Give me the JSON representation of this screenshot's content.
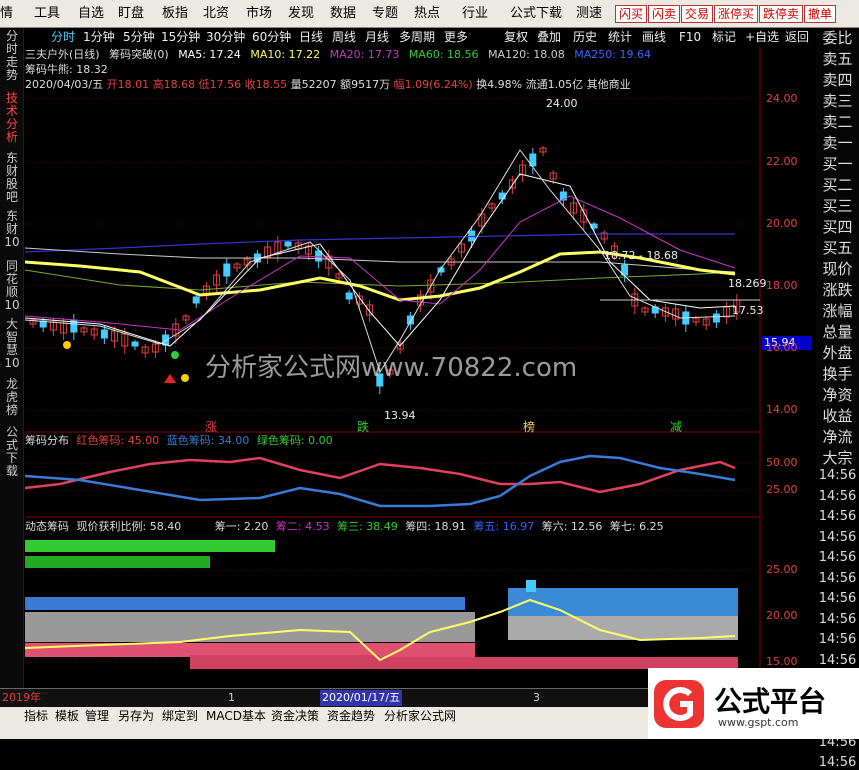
{
  "top_menu": {
    "items": [
      "情",
      "工具",
      "自选",
      "盯盘",
      "板指",
      "北资",
      "市场",
      "发现",
      "数据",
      "专题",
      "热点",
      "行业",
      "公式下载",
      "测速"
    ],
    "red_buttons": [
      "闪买",
      "闪卖",
      "交易",
      "涨停买",
      "跌停卖",
      "撤单"
    ]
  },
  "sidebar": {
    "items": [
      "分时走势",
      "技术分析",
      "东财股吧",
      "东财10",
      "同花顺10",
      "大智慧10",
      "龙虎榜",
      "公式下载"
    ],
    "active_index": 1
  },
  "periods": {
    "items": [
      "分时",
      "1分钟",
      "5分钟",
      "15分钟",
      "30分钟",
      "60分钟",
      "日线",
      "周线",
      "月线",
      "多周期",
      "更多"
    ],
    "active_index": 0
  },
  "toolbar": {
    "items": [
      "复权",
      "叠加",
      "历史",
      "统计",
      "画线",
      "F10",
      "标记",
      "+自选",
      "返回"
    ]
  },
  "stock": {
    "name": "三夫户外(日线)",
    "indicator": "筹码突破(0)",
    "ma5": "MA5: 17.24",
    "ma10": "MA10: 17.22",
    "ma20": "MA20: 17.73",
    "ma60": "MA60: 18.56",
    "ma120": "MA120: 18.08",
    "ma250": "MA250: 19.64",
    "chip_line": "筹码牛熊: 18.32"
  },
  "ohlc": {
    "date": "2020/04/03/五",
    "open": "开18.01",
    "high": "高18.68",
    "low": "低17.56",
    "close": "收18.55",
    "vol": "量52207",
    "amount": "额9517万",
    "change": "幅1.09(6.24%)",
    "turnover": "换4.98%",
    "float": "流通1.05亿",
    "sector": "其他商业"
  },
  "price_axis": [
    "24.00",
    "22.00",
    "20.00",
    "18.00",
    "16.00",
    "14.00"
  ],
  "price_labels": {
    "high": "24.00",
    "low": "13.94",
    "mid": "18.72 - 18.68",
    "r1": "18.269",
    "r2": "17.53",
    "current": "15.94"
  },
  "markers": [
    "涨",
    "跌",
    "榜",
    "减"
  ],
  "right_panel": [
    "委比",
    "卖五",
    "卖四",
    "卖三",
    "卖二",
    "卖一",
    "买一",
    "买二",
    "买三",
    "买四",
    "买五",
    "现价",
    "涨跌",
    "涨幅",
    "总量",
    "外盘",
    "换手",
    "净资",
    "收益",
    "净流",
    "大宗"
  ],
  "right_times": [
    "14:56",
    "14:56",
    "14:56",
    "14:56",
    "14:56",
    "14:56",
    "14:56",
    "14:56",
    "14:56",
    "14:56",
    "14:56",
    "14:56",
    "14:56",
    "14:56",
    "14:56"
  ],
  "chip_panel": {
    "title": "筹码分布",
    "red": "红色筹码: 45.00",
    "blue": "蓝色筹码: 34.00",
    "green": "绿色筹码: 0.00",
    "axis": [
      "50.00",
      "25.00"
    ]
  },
  "dyn_panel": {
    "title": "动态筹码",
    "profit": "现价获利比例: 58.40",
    "c1": "筹一: 2.20",
    "c2": "筹二: 4.53",
    "c3": "筹三: 38.49",
    "c4": "筹四: 18.91",
    "c5": "筹五: 16.97",
    "c6": "筹六: 12.56",
    "c7": "筹七: 6.25",
    "axis": [
      "25.00",
      "20.00",
      "15.00"
    ]
  },
  "bottom_bar": {
    "year": "2019年",
    "mark1": "1",
    "date": "2020/01/17/五",
    "mark2": "3"
  },
  "bottom_tabs": [
    "指标",
    "模板",
    "管理",
    "另存为",
    "绑定到",
    "MACD基本",
    "资金决策",
    "资金趋势",
    "分析家公式网"
  ],
  "watermark": "分析家公式网www.70822.com",
  "logo": {
    "text": "公式平台",
    "url": "www.gspt.com"
  },
  "colors": {
    "red": "#e04040",
    "blue": "#3a7bd5",
    "green": "#3c3",
    "yellow": "#ff6",
    "cyan": "#4cf"
  }
}
